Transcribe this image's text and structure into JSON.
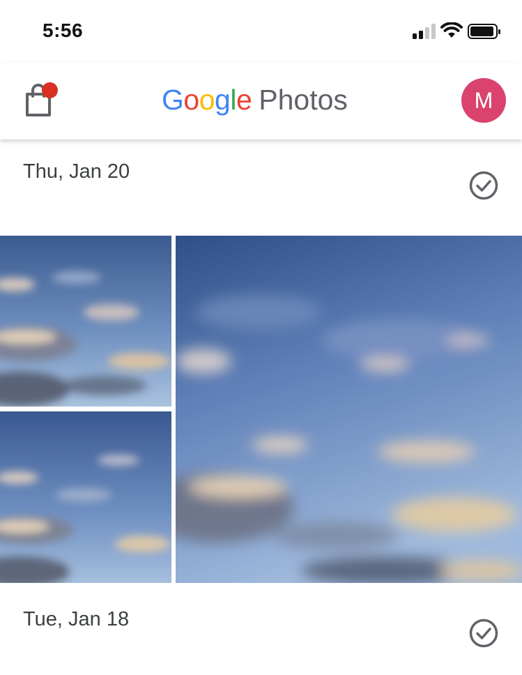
{
  "status_bar": {
    "time": "5:56",
    "signal_icon": "cellular-signal-icon",
    "wifi_icon": "wifi-icon",
    "battery_icon": "battery-icon"
  },
  "header": {
    "logo_google": "Google",
    "logo_photos": "Photos",
    "avatar_initial": "M",
    "shop_icon": "shopping-bag-icon",
    "notification_color": "#d93025",
    "avatar_color": "#d9436e"
  },
  "sections": [
    {
      "date": "Thu, Jan 20",
      "select_icon": "check-circle-icon",
      "photos": [
        "sky-clouds-1",
        "sky-clouds-2",
        "sky-clouds-3"
      ]
    },
    {
      "date": "Tue, Jan 18",
      "select_icon": "check-circle-icon"
    }
  ],
  "colors": {
    "google_blue": "#4285F4",
    "google_red": "#EA4335",
    "google_yellow": "#FBBC05",
    "google_green": "#34A853",
    "text_dark": "#3c4043"
  }
}
